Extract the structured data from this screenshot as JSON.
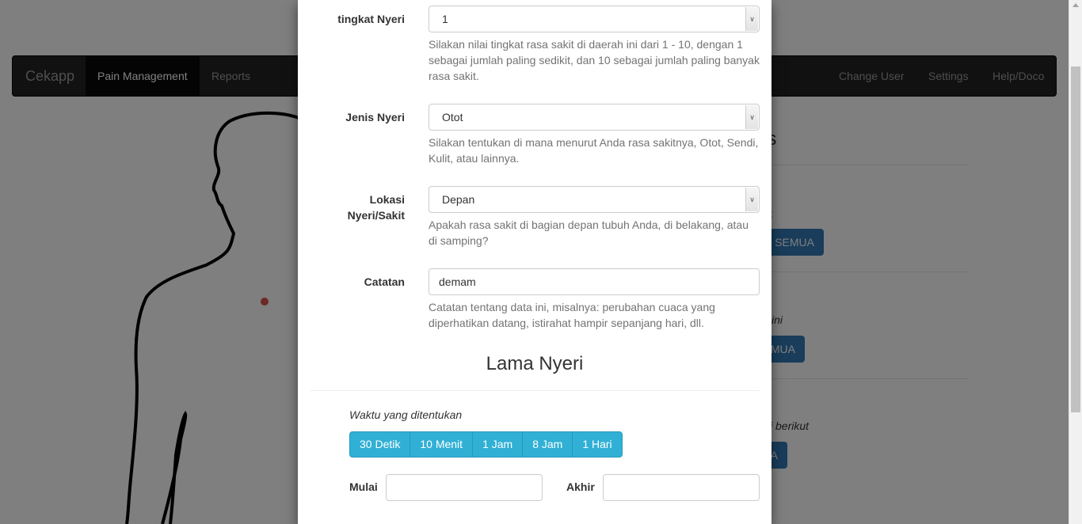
{
  "navbar": {
    "brand": "Cekapp",
    "items": [
      {
        "label": "Pain Management",
        "active": true
      },
      {
        "label": "Reports"
      }
    ],
    "right_items": [
      {
        "label": "Change User"
      },
      {
        "label": "Settings"
      },
      {
        "label": "Help/Doco"
      }
    ]
  },
  "background": {
    "title_fragment": "ns",
    "colon_fragment": ":",
    "btn1_fragment": "SEMUA",
    "text2_fragment": "ini",
    "btn2_fragment": "MUA",
    "text3_fragment": "i berikut",
    "btn3_fragment": "A",
    "pain_marker_color": "#d9534f"
  },
  "modal": {
    "fields": [
      {
        "label": "tingkat Nyeri",
        "value": "1",
        "help": "Silakan nilai tingkat rasa sakit di daerah ini dari 1 - 10, dengan 1 sebagai jumlah paling sedikit, dan 10 sebagai jumlah paling banyak rasa sakit."
      },
      {
        "label": "Jenis Nyeri",
        "value": "Otot",
        "help": "Silakan tentukan di mana menurut Anda rasa sakitnya, Otot, Sendi, Kulit, atau lainnya."
      },
      {
        "label_line1": "Lokasi",
        "label_line2": "Nyeri/Sakit",
        "value": "Depan",
        "help": "Apakah rasa sakit di bagian depan tubuh Anda, di belakang, atau di samping?"
      },
      {
        "label": "Catatan",
        "value": "demam",
        "help": "Catatan tentang data ini, misalnya: perubahan cuaca yang diperhatikan datang, istirahat hampir sepanjang hari, dll."
      }
    ],
    "duration_title": "Lama Nyeri",
    "preset_label": "Waktu yang ditentukan",
    "presets": [
      "30 Detik",
      "10 Menit",
      "1 Jam",
      "8 Jam",
      "1 Hari"
    ],
    "start_label": "Mulai",
    "start_value": "",
    "end_label": "Akhir",
    "end_value": ""
  },
  "colors": {
    "accent": "#31b0d5",
    "primary": "#337ab7",
    "navbar": "#222222"
  }
}
